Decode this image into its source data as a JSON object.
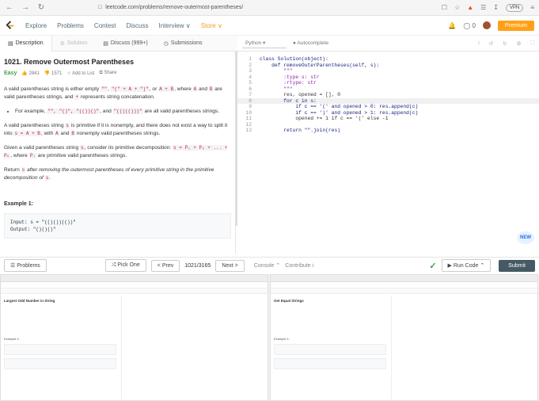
{
  "browser": {
    "url": "leetcode.com/problems/remove-outermost-parentheses/",
    "vpn": "VPN"
  },
  "nav": {
    "items": [
      "Explore",
      "Problems",
      "Contest",
      "Discuss",
      "Interview ∨",
      "Store ∨"
    ],
    "notif_count": "0",
    "premium": "Premium"
  },
  "tabs": [
    "Description",
    "Solution",
    "Discuss (999+)",
    "Submissions"
  ],
  "problem": {
    "title": "1021. Remove Outermost Parentheses",
    "difficulty": "Easy",
    "likes": "2841",
    "dislikes": "1571",
    "add_to_list": "Add to List",
    "share": "Share",
    "p1a": "A valid parentheses string is either empty ",
    "p1b": "\"\"",
    "p1c": ", ",
    "p1d": "\"(\" + A + \")\"",
    "p1e": ", or ",
    "p1f": "A + B",
    "p1g": ", where ",
    "p1h": "A",
    "p1i": " and ",
    "p1j": "B",
    "p1k": " are valid parentheses strings, and ",
    "p1l": "+",
    "p1m": " represents string concatenation.",
    "bullet_a": "For example, ",
    "bullet_b": "\"\", \"()\", \"(())()\"",
    "bullet_c": ", and ",
    "bullet_d": "\"(()(()))\"",
    "bullet_e": " are all valid parentheses strings.",
    "p2a": "A valid parentheses string ",
    "p2b": "s",
    "p2c": " is primitive if it is nonempty, and there does not exist a way to split it into ",
    "p2d": "s = A + B",
    "p2e": ", with ",
    "p2f": "A",
    "p2g": " and ",
    "p2h": "B",
    "p2i": " nonempty valid parentheses strings.",
    "p3a": "Given a valid parentheses string ",
    "p3b": "s",
    "p3c": ", consider its primitive decomposition: ",
    "p3d": "s = P₁ + P₂ + ... + Pₖ",
    "p3e": ", where ",
    "p3f": "Pᵢ",
    "p3g": " are primitive valid parentheses strings.",
    "p4a": "Return ",
    "p4b": "s",
    "p4c": " after removing the outermost parentheses of every primitive string in the primitive decomposition of ",
    "p4d": "s",
    "p4e": ".",
    "example_title": "Example 1:",
    "example_input": "Input: s = \"(()())(())\"",
    "example_output": "Output: \"()()()\""
  },
  "editor": {
    "language": "Python",
    "autocomplete": "Autocomplete",
    "lines": [
      {
        "n": "1",
        "t": "class Solution(object):"
      },
      {
        "n": "2",
        "t": "    def removeOuterParentheses(self, s):"
      },
      {
        "n": "3",
        "t": "        \"\"\""
      },
      {
        "n": "4",
        "t": "        :type s: str"
      },
      {
        "n": "5",
        "t": "        :rtype: str"
      },
      {
        "n": "6",
        "t": "        \"\"\""
      },
      {
        "n": "7",
        "t": "        res, opened = [], 0"
      },
      {
        "n": "8",
        "t": "        for c in s:"
      },
      {
        "n": "9",
        "t": "            if c == '(' and opened > 0: res.append(c)"
      },
      {
        "n": "10",
        "t": "            if c == ')' and opened > 1: res.append(c)"
      },
      {
        "n": "11",
        "t": "            opened += 1 if c == '(' else -1"
      },
      {
        "n": "12",
        "t": ""
      },
      {
        "n": "13",
        "t": "        return \"\".join(res)"
      }
    ],
    "new_badge": "NEW"
  },
  "bottom": {
    "problems": "Problems",
    "pick_one": "Pick One",
    "prev": "Prev",
    "counter": "1021/3165",
    "next": "Next",
    "console": "Console",
    "contribute": "Contribute i",
    "run_code": "Run Code",
    "submit": "Submit"
  },
  "thumbs": {
    "left_title": "Largest Odd Number in String",
    "left_example": "Example 1:",
    "right_title": "Get Equal Strings",
    "right_example": "Example 1:"
  }
}
